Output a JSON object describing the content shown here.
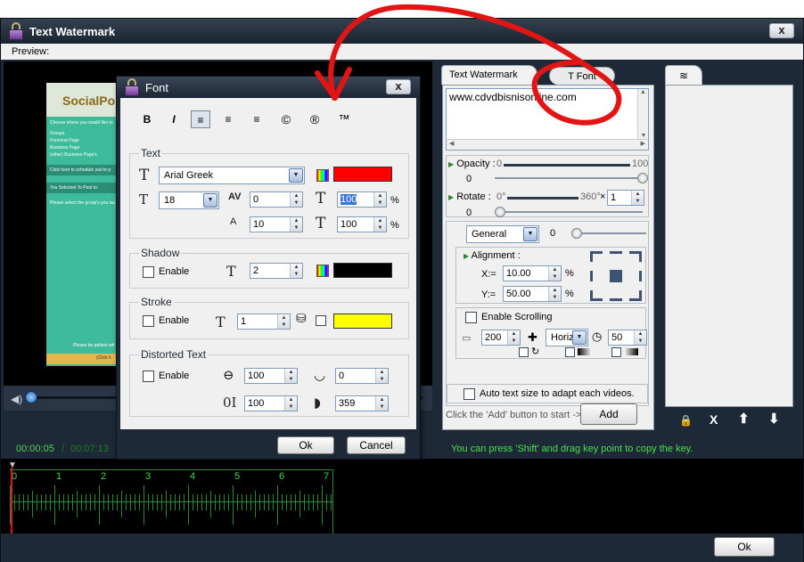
{
  "window": {
    "title": "Text Watermark",
    "close_label": "x"
  },
  "preview_label": "Preview:",
  "preview_page": {
    "brand": "SocialPos",
    "lines": [
      "Choose where you would like to",
      "Groups",
      "Personal Page",
      "Business Page",
      "(other) Business Page's",
      "Click here to schedule you're p",
      "You Selected To Post to:",
      "Please select the group's you wa",
      "Please be patient wh",
      "(Click h"
    ]
  },
  "time": {
    "current": "00:00:05",
    "sep": "/",
    "total": "00:07:13"
  },
  "tip": "You can press 'Shift' and drag key point to copy the key.",
  "timeline": {
    "ticks": [
      "0",
      "1",
      "2",
      "3",
      "4",
      "5",
      "6",
      "7"
    ]
  },
  "main_ok": "Ok",
  "right_panel": {
    "tabs": [
      "Text Watermark",
      "T Font"
    ],
    "text_value": "www.cdvdbisnisonline.com",
    "opacity": {
      "label": "Opacity :",
      "min": "0",
      "max": "100",
      "value": "0",
      "level": 1.0
    },
    "rotate": {
      "label": "Rotate :",
      "min": "0°",
      "max": "360°",
      "times": "×",
      "factor": "1",
      "value": "0",
      "level": 0.0
    },
    "general": {
      "select": "General",
      "value": "0"
    },
    "alignment": {
      "label": "Alignment :",
      "x_label": "X:=",
      "x": "10.00",
      "y_label": "Y:=",
      "y": "50.00",
      "unit": "%"
    },
    "scrolling": {
      "label": "Enable Scrolling",
      "speed": "200",
      "direction": "Horiz",
      "time": "50"
    },
    "auto_size": "Auto text size to adapt each videos.",
    "add_hint": "Click the 'Add' button to start ->",
    "add_button": "Add"
  },
  "font_dialog": {
    "title": "Font",
    "close_label": "x",
    "format_buttons": [
      "B",
      "I",
      "≡",
      "≡",
      "≡",
      "©",
      "®",
      "™"
    ],
    "text_group": "Text",
    "font_name": "Arial Greek",
    "font_size": "18",
    "spacing": "0",
    "scale_w": "100",
    "line_spacing": "10",
    "scale_h": "100",
    "pct": "%",
    "text_color": "#ff0000",
    "shadow_group": "Shadow",
    "shadow_enable": "Enable",
    "shadow_value": "2",
    "shadow_color": "#000000",
    "stroke_group": "Stroke",
    "stroke_enable": "Enable",
    "stroke_value": "1",
    "stroke_color": "#ffff00",
    "distort_group": "Distorted Text",
    "distort_enable": "Enable",
    "distort_w": "100",
    "distort_h": "100",
    "angle_a": "0",
    "angle_b": "359",
    "ok": "Ok",
    "cancel": "Cancel"
  }
}
